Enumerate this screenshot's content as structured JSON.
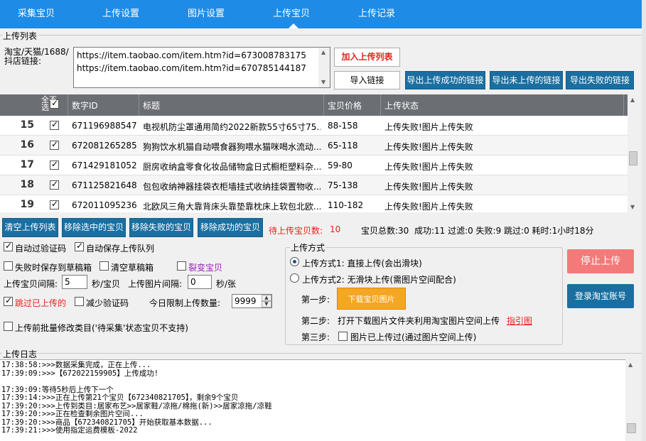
{
  "tabs": [
    "采集宝贝",
    "上传设置",
    "图片设置",
    "上传宝贝",
    "上传记录"
  ],
  "active_tab": "上传宝贝",
  "upload_list": {
    "group_title": "上传列表",
    "links_label": "淘宝/天猫/1688/抖店链接:",
    "links_value": "https://item.taobao.com/item.htm?id=673008783175\nhttps://item.taobao.com/item.htm?id=670785144187",
    "add_button": "加入上传列表",
    "import_button": "导入链接",
    "export_success_button": "导出上传成功的链接",
    "export_not_uploaded_button": "导出未上传的链接",
    "export_failed_button": "导出失败的链接"
  },
  "table": {
    "headers": [
      "全不选",
      "数字ID",
      "标题",
      "宝贝价格",
      "上传状态"
    ],
    "rows": [
      {
        "num": "15",
        "checked": true,
        "id": "671196988547",
        "title": "电视机防尘罩通用简约2022新款55寸65寸75...",
        "price": "88-158",
        "status": "上传失败!图片上传失败"
      },
      {
        "num": "16",
        "checked": true,
        "id": "672081265285",
        "title": "狗狗饮水机猫自动喂食器狗喂水猫咪喝水流动...",
        "price": "65-118",
        "status": "上传失败!图片上传失败"
      },
      {
        "num": "17",
        "checked": true,
        "id": "671429181052",
        "title": "厨房收纳盒零食化妆品储物盒日式橱柜塑料杂...",
        "price": "59-80",
        "status": "上传失败!图片上传失败"
      },
      {
        "num": "18",
        "checked": true,
        "id": "671125821648",
        "title": "包包收纳神器挂袋衣柜墙挂式收纳挂袋置物收...",
        "price": "75-138",
        "status": "上传失败!图片上传失败"
      },
      {
        "num": "19",
        "checked": true,
        "id": "672011095236",
        "title": "北欧风三角大靠背床头靠垫靠枕床上软包北欧...",
        "price": "110-182",
        "status": "上传失败!图片上传失败"
      }
    ]
  },
  "actions": {
    "clear_list": "清空上传列表",
    "remove_selected": "移除选中的宝贝",
    "remove_failed": "移除失败的宝贝",
    "remove_success": "移除成功的宝贝",
    "pending_label": "待上传宝贝数:",
    "pending_value": "10",
    "stats": "宝贝总数:30  成功:11 过滤:0 失败:9 跳过:0 耗时:1小时18分"
  },
  "options": {
    "auto_captcha": "自动过验证码",
    "auto_save_queue": "自动保存上传队列",
    "save_draft_on_fail": "失败时保存到草稿箱",
    "clear_drafts": "清空草稿箱",
    "split_item": "裂变宝贝",
    "interval_label": "上传宝贝间隔:",
    "interval_value": "5",
    "interval_unit": "秒/宝贝",
    "img_interval_label": "上传图片间隔:",
    "img_interval_value": "0",
    "img_interval_unit": "秒/张",
    "skip_uploaded": "跳过已上传的",
    "reduce_captcha": "减少验证码",
    "daily_limit_label": "今日限制上传数量:",
    "daily_limit_value": "9999",
    "batch_modify": "上传前批量修改类目('待采集'状态宝贝不支持)"
  },
  "upload_mode": {
    "title": "上传方式",
    "mode1": "上传方式1: 直接上传(会出滑块)",
    "mode2": "上传方式2: 无滑块上传(需图片空间配合)",
    "step1": "第一步:",
    "download_button": "下载宝贝图片",
    "step2": "第二步:",
    "step2_text": "打开下载图片文件夹利用淘宝图片空间上传",
    "guide_link": "指引图",
    "step3": "第三步:",
    "step3_text": "图片已上传过(通过图片空间上传)"
  },
  "buttons": {
    "stop": "停止上传",
    "login": "登录淘宝账号"
  },
  "log": {
    "title": "上传日志",
    "text": "17:38:58:>>>数据采集完成，正在上传...\n17:39:09:>>>【672022159905】上传成功!\n\n17:39:09:等待5秒后上传下一个\n17:39:14:>>>正在上传第21个宝贝【672340821705】，剩余9个宝贝\n17:39:20:>>>上传到类目:居家布艺>>居家鞋/凉拖/棉拖(新)>>居家凉拖/凉鞋\n17:39:20:>>>正在检查剩余图片空间...\n17:39:20:>>>商品【672340821705】开始获取基本数据...\n17:39:21:>>>使用指定运费模板-2022"
  }
}
